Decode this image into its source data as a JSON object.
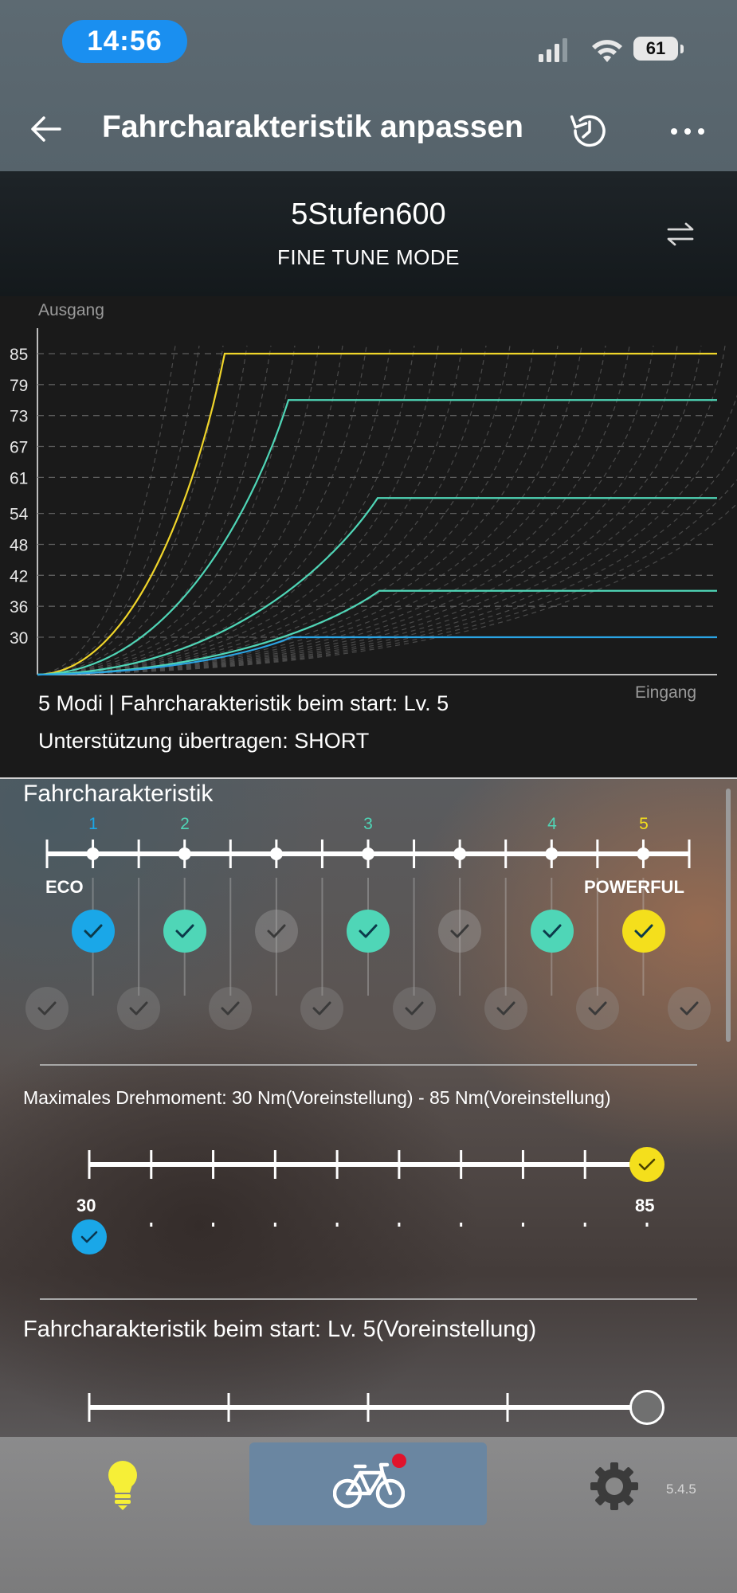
{
  "status_bar": {
    "time": "14:56",
    "battery": "61"
  },
  "header": {
    "title": "Fahrcharakteristik anpassen",
    "back_icon": "arrow-left-icon",
    "history_icon": "history-icon",
    "more_icon": "more-icon"
  },
  "profile": {
    "name": "5Stufen600",
    "mode": "FINE TUNE MODE",
    "swap_icon": "swap-icon"
  },
  "chart_data": {
    "type": "line",
    "ylabel": "Ausgang",
    "xlabel": "Eingang",
    "yticks": [
      30,
      36,
      42,
      48,
      54,
      61,
      67,
      73,
      79,
      85
    ],
    "grid": "dashed horizontal and diagonal reference curves",
    "series": [
      {
        "color": "#f0d52a",
        "plateau": 85
      },
      {
        "color": "#4fd6b7",
        "plateau": 76
      },
      {
        "color": "#4fd6b7",
        "plateau": 57
      },
      {
        "color": "#4fd6b7",
        "plateau": 39
      },
      {
        "color": "#2aa3e3",
        "plateau": 30
      }
    ]
  },
  "chart_info": {
    "line1": "5 Modi | Fahrcharakteristik beim start: Lv. 5",
    "line2": "Unterstützung übertragen: SHORT"
  },
  "characteristic": {
    "title": "Fahrcharakteristik",
    "left_label": "ECO",
    "right_label": "POWERFUL",
    "levels": [
      {
        "num": "1",
        "color": "#1aa7e8"
      },
      {
        "num": "2",
        "color": "#4fd6b7"
      },
      {
        "num": "3",
        "color": "#4fd6b7"
      },
      {
        "num": "4",
        "color": "#4fd6b7"
      },
      {
        "num": "5",
        "color": "#f4df1c"
      }
    ]
  },
  "torque": {
    "title": "Maximales Drehmoment: 30 Nm(Voreinstellung) - 85 Nm(Voreinstellung)",
    "min_value": "30",
    "max_value": "85"
  },
  "start_level": {
    "title": "Fahrcharakteristik beim start: Lv. 5(Voreinstellung)"
  },
  "nav": {
    "items": [
      {
        "icon": "lightbulb-icon",
        "active": false
      },
      {
        "icon": "bicycle-icon",
        "active": true
      },
      {
        "icon": "gear-icon",
        "active": false
      }
    ],
    "version": "5.4.5"
  },
  "colors": {
    "blue": "#1aa7e8",
    "teal": "#4fd6b7",
    "yellow": "#f4df1c",
    "nav_active": "#6a86a1",
    "badge": "#e0132c"
  }
}
